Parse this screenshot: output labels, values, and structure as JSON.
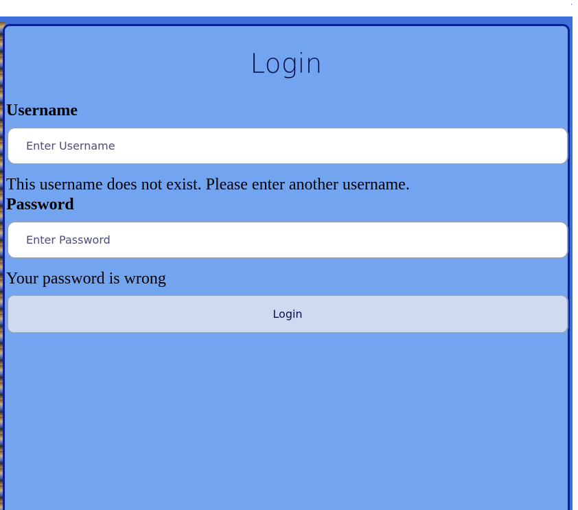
{
  "page": {
    "title": "Login"
  },
  "login_form": {
    "username": {
      "label": "Username",
      "placeholder": "Enter Username",
      "value": "",
      "error": "This username does not exist. Please enter another username."
    },
    "password": {
      "label": "Password",
      "placeholder": "Enter Password",
      "value": "",
      "error": "Your password is wrong"
    },
    "submit_label": "Login"
  },
  "colors": {
    "panel_background": "#73a4f0",
    "panel_border": "#0a1c9b",
    "button_background": "#cfd9f0",
    "page_background": "#ffffff"
  },
  "icons": {
    "corner_dot": "dot-icon"
  }
}
